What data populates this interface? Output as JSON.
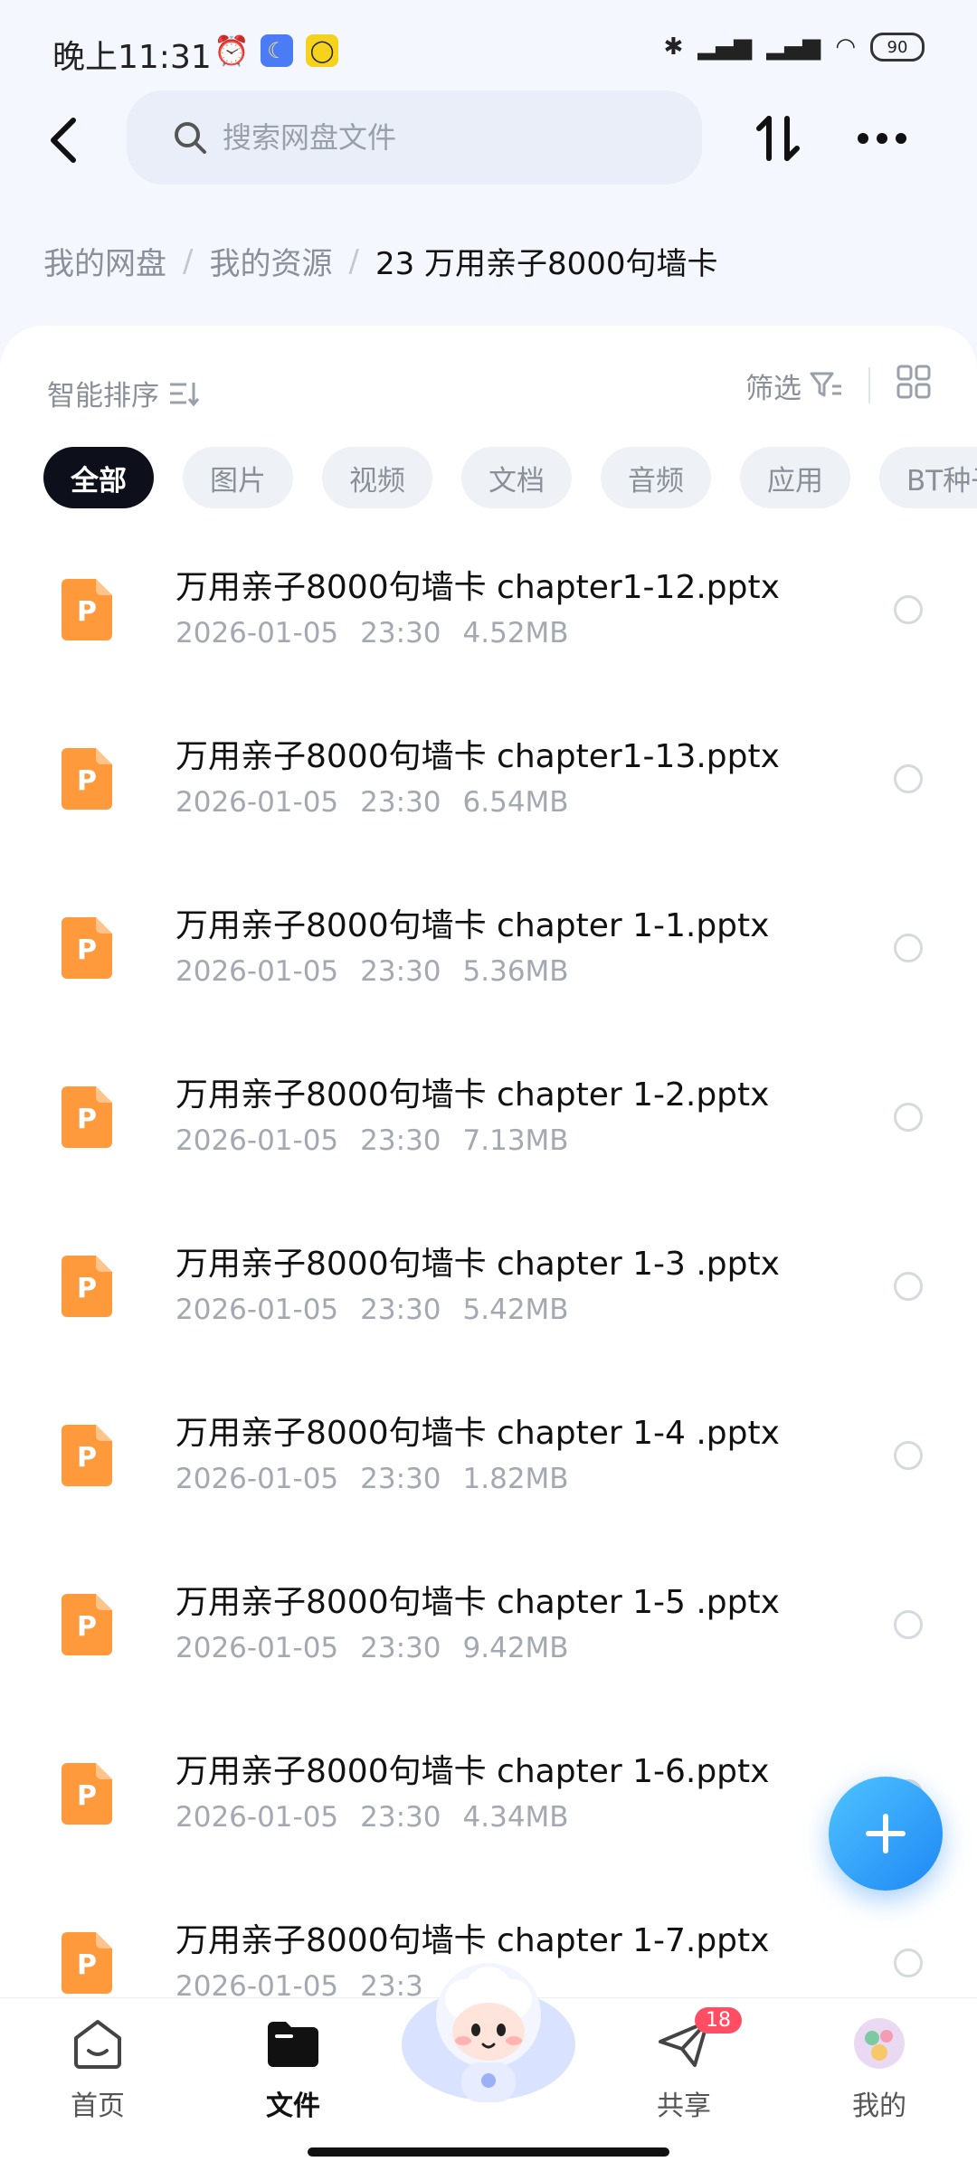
{
  "status_bar": {
    "time": "晚上11:31",
    "battery": "90"
  },
  "header": {
    "search_placeholder": "搜索网盘文件"
  },
  "breadcrumb": [
    {
      "label": "我的网盘"
    },
    {
      "label": "我的资源"
    },
    {
      "label": "23  万用亲子8000句墙卡"
    }
  ],
  "toolbar": {
    "sort_label": "智能排序",
    "filter_label": "筛选"
  },
  "chips": [
    "全部",
    "图片",
    "视频",
    "文档",
    "音频",
    "应用",
    "BT种子"
  ],
  "files": [
    {
      "name": "万用亲子8000句墙卡 chapter1-12.pptx",
      "date": "2026-01-05",
      "time": "23:30",
      "size": "4.52MB"
    },
    {
      "name": "万用亲子8000句墙卡 chapter1-13.pptx",
      "date": "2026-01-05",
      "time": "23:30",
      "size": "6.54MB"
    },
    {
      "name": "万用亲子8000句墙卡 chapter 1-1.pptx",
      "date": "2026-01-05",
      "time": "23:30",
      "size": "5.36MB"
    },
    {
      "name": "万用亲子8000句墙卡 chapter 1-2.pptx",
      "date": "2026-01-05",
      "time": "23:30",
      "size": "7.13MB"
    },
    {
      "name": "万用亲子8000句墙卡 chapter 1-3 .pptx",
      "date": "2026-01-05",
      "time": "23:30",
      "size": "5.42MB"
    },
    {
      "name": "万用亲子8000句墙卡 chapter 1-4 .pptx",
      "date": "2026-01-05",
      "time": "23:30",
      "size": "1.82MB"
    },
    {
      "name": "万用亲子8000句墙卡 chapter 1-5 .pptx",
      "date": "2026-01-05",
      "time": "23:30",
      "size": "9.42MB"
    },
    {
      "name": "万用亲子8000句墙卡 chapter 1-6.pptx",
      "date": "2026-01-05",
      "time": "23:30",
      "size": "4.34MB"
    },
    {
      "name": "万用亲子8000句墙卡 chapter 1-7.pptx",
      "date": "2026-01-05",
      "time": "23:3",
      "size": ""
    }
  ],
  "bottom_nav": [
    {
      "label": "首页"
    },
    {
      "label": "文件"
    },
    {
      "label": "共享"
    },
    {
      "label": "我的"
    }
  ],
  "share_badge": "18",
  "colors": {
    "accent": "#1e88f5",
    "pptx_icon": "#ff9a3c",
    "chip_active": "#0d0f1a",
    "badge": "#ff4d63"
  }
}
